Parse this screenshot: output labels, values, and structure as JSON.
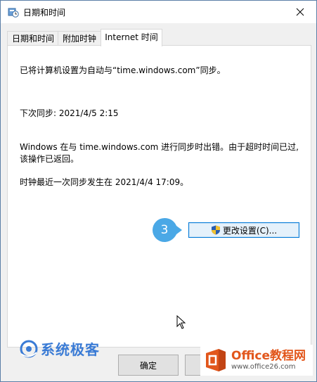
{
  "window": {
    "title": "日期和时间"
  },
  "tabs": [
    {
      "label": "日期和时间"
    },
    {
      "label": "附加时钟"
    },
    {
      "label": "Internet 时间"
    }
  ],
  "active_tab": 2,
  "panel": {
    "sync_configured": "已将计算机设置为自动与“time.windows.com”同步。",
    "next_sync": "下次同步: 2021/4/5 2:15",
    "error_line1": "Windows 在与 time.windows.com 进行同步时出错。由于超时时间已过,",
    "error_line2": "该操作已返回。",
    "last_sync": "时钟最近一次同步发生在 2021/4/4 17:09。",
    "change_settings_label": "更改设置(C)..."
  },
  "annotation": {
    "step_number": "3",
    "color": "#4aa8e6"
  },
  "footer": {
    "ok_label": "确定"
  },
  "watermarks": {
    "left_text": "系统极客",
    "right_main": "Office教程网",
    "right_sub": "www.office26.com"
  },
  "icons": [
    "clock-app-icon",
    "close-icon",
    "uac-shield-icon",
    "mouse-cursor-icon"
  ]
}
